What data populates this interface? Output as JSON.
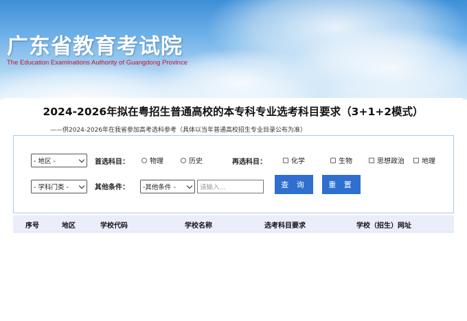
{
  "header": {
    "title": "广东省教育考试院",
    "subtitle": "The Education Examinations Authority of Guangdong Province"
  },
  "page": {
    "title": "2024-2026年拟在粤招生普通高校的本专科专业选考科目要求（3+1+2模式）",
    "note": "——供2024-2026年在我省参加高考选科参考（具体以当年普通高校招生专业目录公布为准）"
  },
  "filters": {
    "region_select": "- 地区 -",
    "category_select": "- 学科门类 -",
    "first_subject_label": "首选科目：",
    "first_subject_options": [
      "物理",
      "历史"
    ],
    "reselect_label": "再选科目：",
    "reselect_options": [
      "化学",
      "生物",
      "思想政治",
      "地理"
    ],
    "other_label": "其他条件：",
    "other_select": "-其他条件 -",
    "input_placeholder": "请输入...",
    "search_button": "查 询",
    "reset_button": "重 置"
  },
  "table": {
    "headers": [
      "序号",
      "地区",
      "学校代码",
      "学校名称",
      "选考科目要求",
      "学校（招生）网址"
    ]
  }
}
